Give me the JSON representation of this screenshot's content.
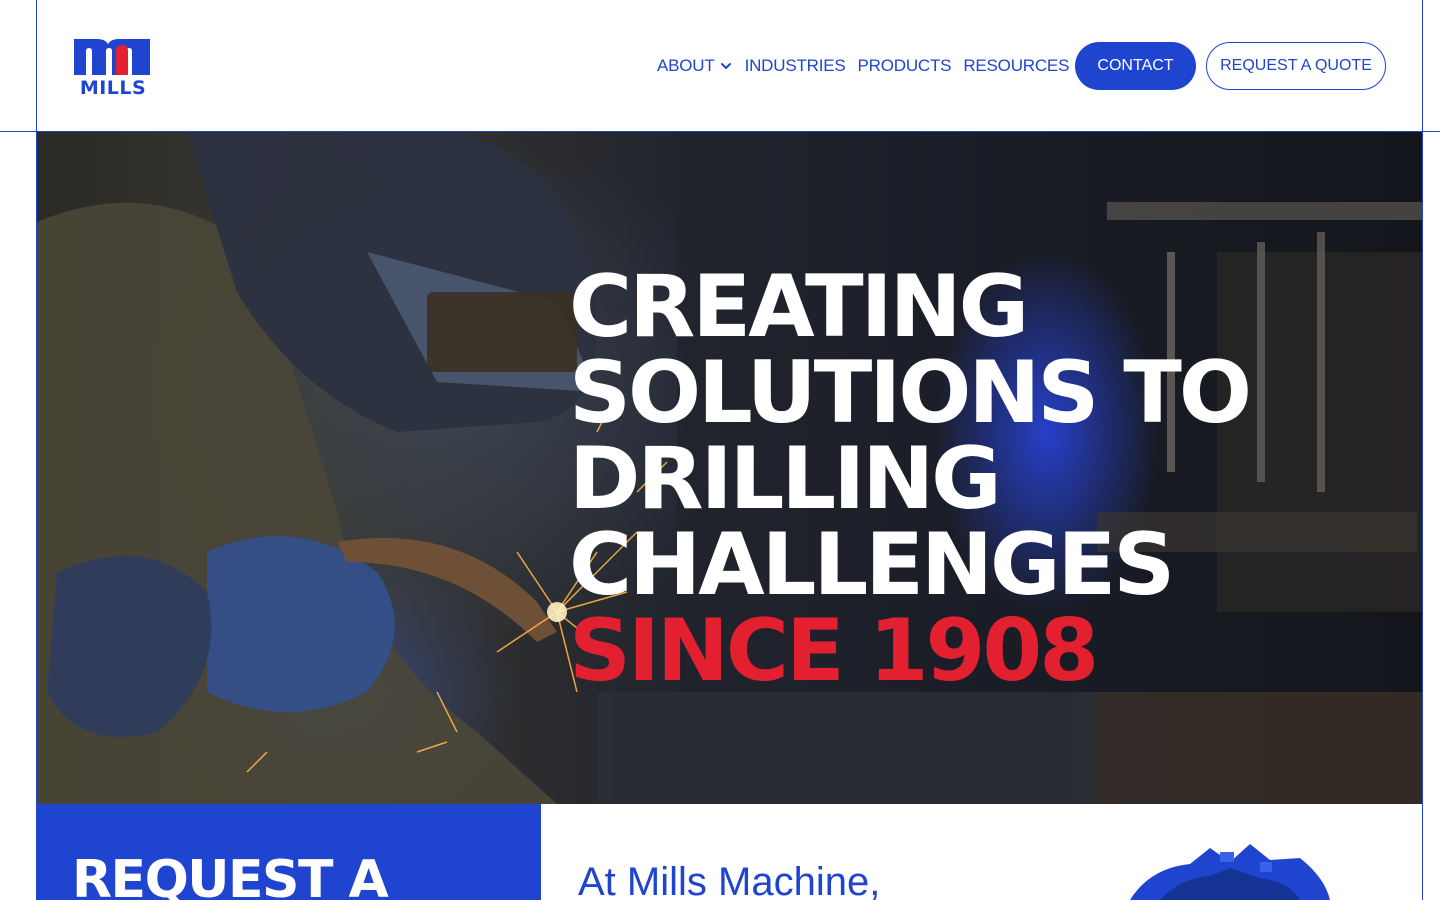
{
  "brand": {
    "name": "MILLS",
    "primary_color": "#1f45d0",
    "accent_color": "#e3202f"
  },
  "nav": {
    "items": [
      {
        "label": "ABOUT",
        "has_dropdown": true
      },
      {
        "label": "INDUSTRIES",
        "has_dropdown": false
      },
      {
        "label": "PRODUCTS",
        "has_dropdown": false
      },
      {
        "label": "RESOURCES",
        "has_dropdown": false
      }
    ],
    "contact_label": "CONTACT",
    "quote_label": "REQUEST A QUOTE"
  },
  "hero": {
    "title_lines": [
      "CREATING",
      "SOLUTIONS TO",
      "DRILLING",
      "CHALLENGES"
    ],
    "title_accent": "SINCE 1908",
    "image_icon": "welder-photo"
  },
  "quote_panel": {
    "title": "REQUEST A"
  },
  "intro": {
    "text": "At Mills Machine,"
  }
}
